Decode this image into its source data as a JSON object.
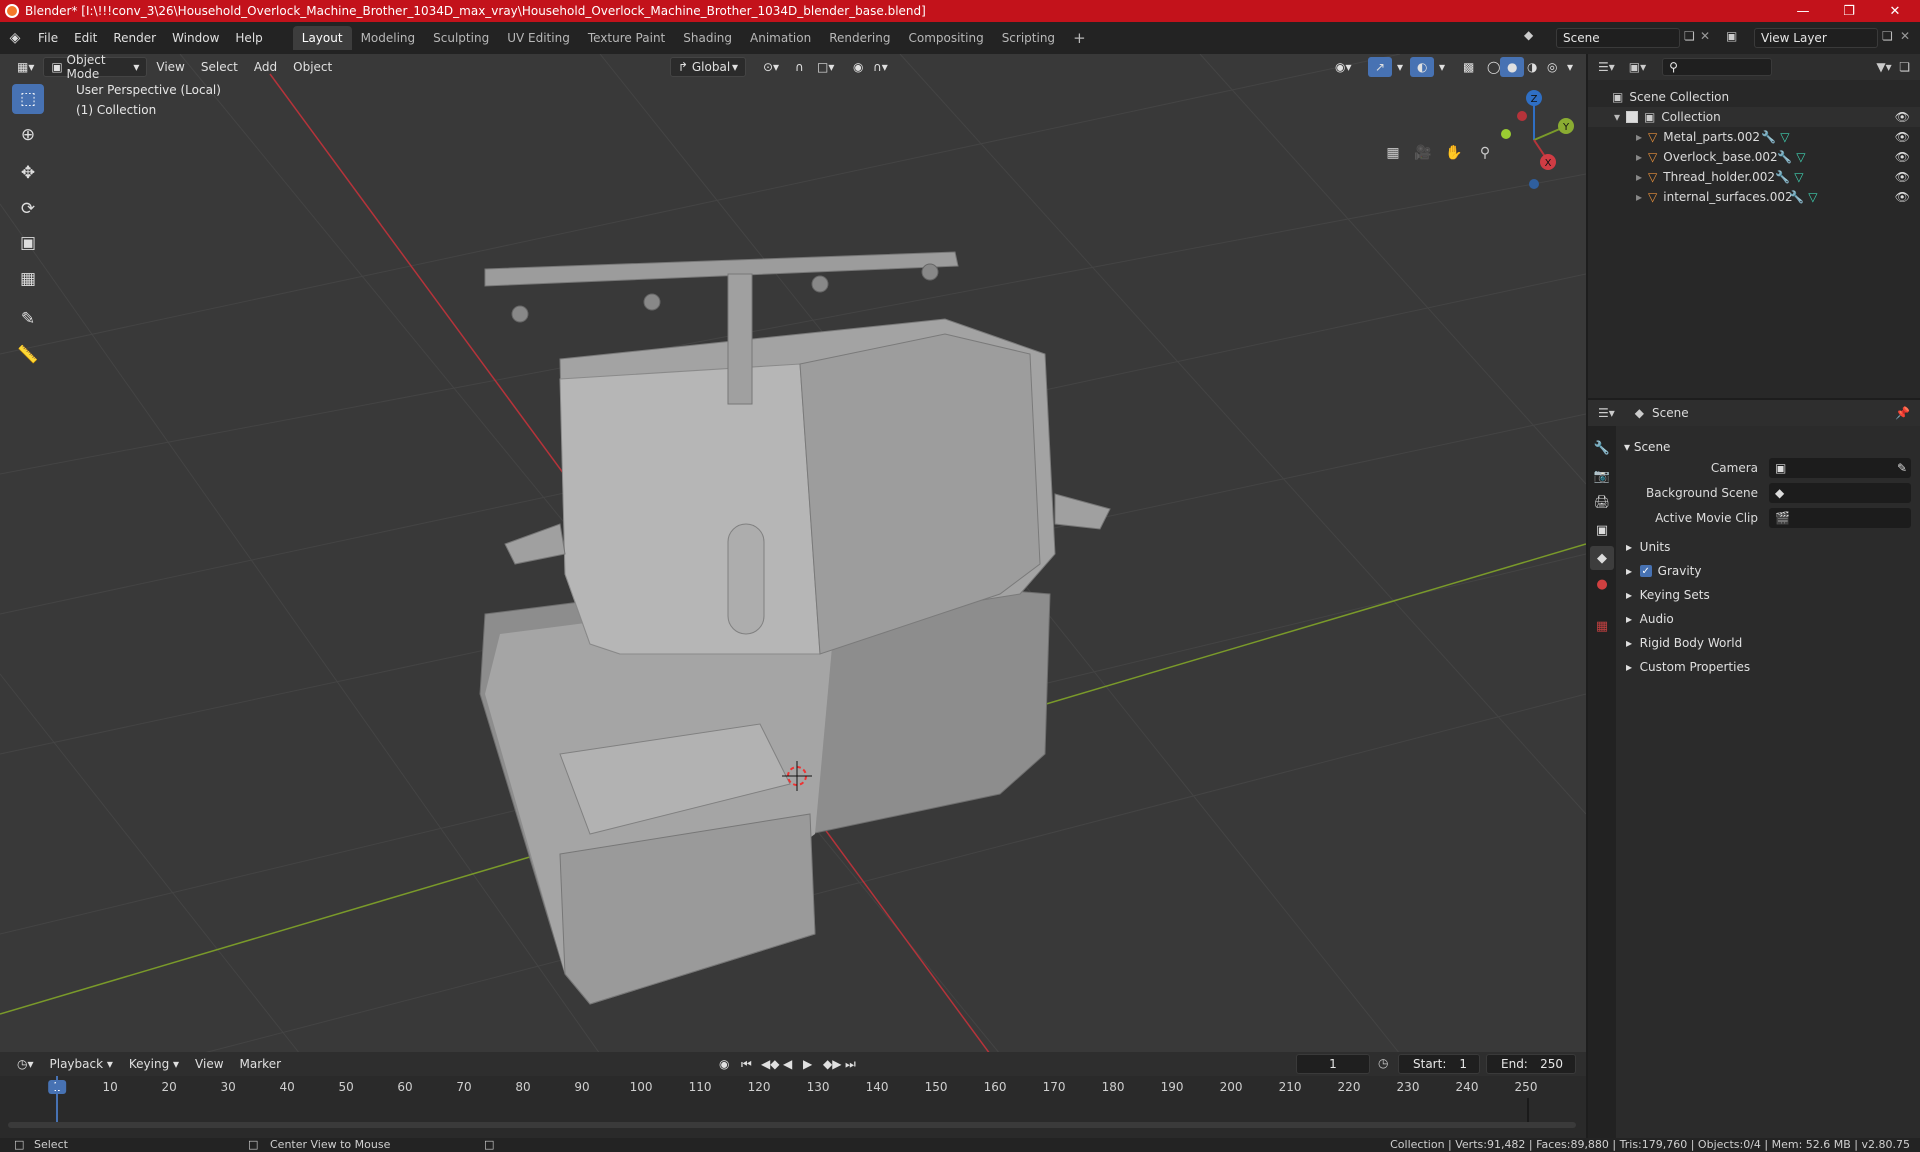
{
  "title": "Blender* [I:\\!!!conv_3\\26\\Household_Overlock_Machine_Brother_1034D_max_vray\\Household_Overlock_Machine_Brother_1034D_blender_base.blend]",
  "menu": [
    "File",
    "Edit",
    "Render",
    "Window",
    "Help"
  ],
  "workspaces": [
    "Layout",
    "Modeling",
    "Sculpting",
    "UV Editing",
    "Texture Paint",
    "Shading",
    "Animation",
    "Rendering",
    "Compositing",
    "Scripting"
  ],
  "active_workspace": "Layout",
  "scene_field": "Scene",
  "view_layer_field": "View Layer",
  "viewport": {
    "mode": "Object Mode",
    "menus": [
      "View",
      "Select",
      "Add",
      "Object"
    ],
    "orientation": "Global",
    "overlay_line1": "User Perspective (Local)",
    "overlay_line2": "(1) Collection",
    "gizmo": {
      "z": "Z",
      "y": "Y",
      "x": "X"
    }
  },
  "outliner": {
    "root": "Scene Collection",
    "collection": "Collection",
    "items": [
      "Metal_parts.002",
      "Overlock_base.002",
      "Thread_holder.002",
      "internal_surfaces.002"
    ]
  },
  "properties": {
    "header": "Scene",
    "section": "Scene",
    "fields": [
      {
        "label": "Camera",
        "value": ""
      },
      {
        "label": "Background Scene",
        "value": ""
      },
      {
        "label": "Active Movie Clip",
        "value": ""
      }
    ],
    "panels": [
      "Units",
      "Gravity",
      "Keying Sets",
      "Audio",
      "Rigid Body World",
      "Custom Properties"
    ],
    "gravity_checked": true
  },
  "timeline": {
    "menus": [
      "Playback",
      "Keying",
      "View",
      "Marker"
    ],
    "current_frame": "1",
    "start_label": "Start:",
    "start": "1",
    "end_label": "End:",
    "end": "250",
    "ticks": [
      "1",
      "10",
      "20",
      "30",
      "40",
      "50",
      "60",
      "70",
      "80",
      "90",
      "100",
      "110",
      "120",
      "130",
      "140",
      "150",
      "160",
      "170",
      "180",
      "190",
      "200",
      "210",
      "220",
      "230",
      "240",
      "250"
    ]
  },
  "status": {
    "left": "Select",
    "middle": "Center View to Mouse",
    "right": "Collection | Verts:91,482 | Faces:89,880 | Tris:179,760 | Objects:0/4 | Mem: 52.6 MB | v2.80.75"
  },
  "colors": {
    "titlebar": "#c3121b",
    "accent": "#4772b3",
    "viewport": "#393939",
    "axis_x": "#b5333a",
    "axis_y": "#7a9a2a"
  }
}
